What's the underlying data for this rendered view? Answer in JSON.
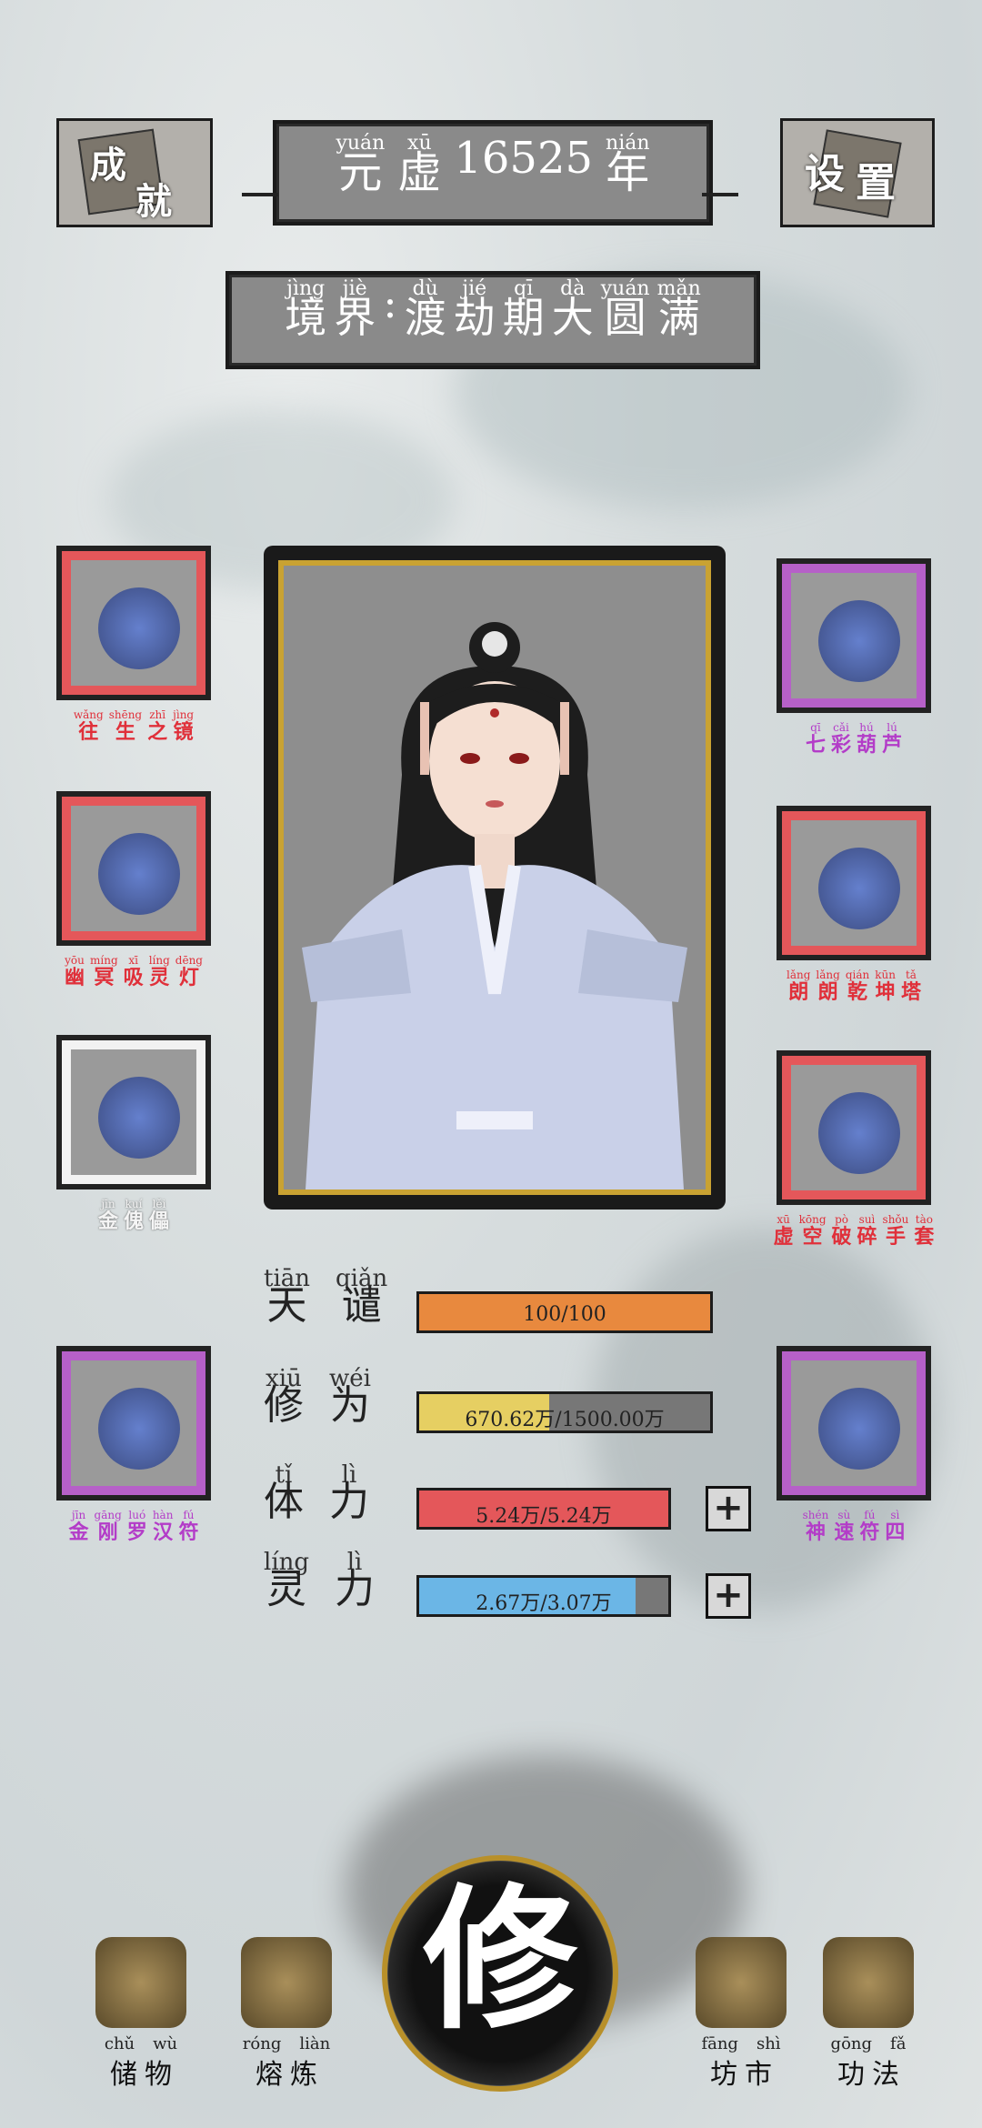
{
  "header": {
    "achievements": [
      "成",
      "就"
    ],
    "settings": [
      "设",
      "置"
    ],
    "era": [
      {
        "py": "yuán",
        "hz": "元"
      },
      {
        "py": "xū",
        "hz": "虚"
      },
      {
        "py": "",
        "hz": "16525"
      },
      {
        "py": "nián",
        "hz": "年"
      }
    ],
    "realm": [
      {
        "py": "jìng",
        "hz": "境"
      },
      {
        "py": "jiè",
        "hz": "界"
      },
      {
        "py": "",
        "hz": ":"
      },
      {
        "py": "dù",
        "hz": "渡"
      },
      {
        "py": "jié",
        "hz": "劫"
      },
      {
        "py": "qī",
        "hz": "期"
      },
      {
        "py": "dà",
        "hz": "大"
      },
      {
        "py": "yuán",
        "hz": "圆"
      },
      {
        "py": "mǎn",
        "hz": "满"
      }
    ]
  },
  "left_items": [
    {
      "py": [
        "wǎng",
        "shēng",
        "zhī",
        "jìng"
      ],
      "hz": [
        "往",
        "生",
        "之",
        "镜"
      ],
      "rarity": "red",
      "icon": "mirror-icon"
    },
    {
      "py": [
        "yōu",
        "míng",
        "xī",
        "líng",
        "dēng"
      ],
      "hz": [
        "幽",
        "冥",
        "吸",
        "灵",
        "灯"
      ],
      "rarity": "red",
      "icon": "lamp-icon"
    },
    {
      "py": [
        "jīn",
        "kuí",
        "lěi"
      ],
      "hz": [
        "金",
        "傀",
        "儡"
      ],
      "rarity": "white",
      "icon": "puppet-icon"
    },
    {
      "py": [
        "jīn",
        "gāng",
        "luó",
        "hàn",
        "fú"
      ],
      "hz": [
        "金",
        "刚",
        "罗",
        "汉",
        "符"
      ],
      "rarity": "purple",
      "icon": "talisman-icon"
    }
  ],
  "right_items": [
    {
      "py": [
        "qī",
        "cǎi",
        "hú",
        "lú"
      ],
      "hz": [
        "七",
        "彩",
        "葫",
        "芦"
      ],
      "rarity": "purple",
      "icon": "gourd-icon"
    },
    {
      "py": [
        "lǎng",
        "lǎng",
        "qián",
        "kūn",
        "tǎ"
      ],
      "hz": [
        "朗",
        "朗",
        "乾",
        "坤",
        "塔"
      ],
      "rarity": "red",
      "icon": "pagoda-icon"
    },
    {
      "py": [
        "xū",
        "kōng",
        "pò",
        "suì",
        "shǒu",
        "tào"
      ],
      "hz": [
        "虚",
        "空",
        "破",
        "碎",
        "手",
        "套"
      ],
      "rarity": "red",
      "icon": "gauntlet-icon"
    },
    {
      "py": [
        "shén",
        "sù",
        "fú",
        "sì"
      ],
      "hz": [
        "神",
        "速",
        "符",
        "四"
      ],
      "rarity": "purple",
      "icon": "talisman-icon"
    }
  ],
  "stats": [
    {
      "py": [
        "tiān",
        "qiǎn"
      ],
      "hz": [
        "天",
        "谴"
      ],
      "text": "100/100",
      "fraction": 1.0,
      "color": "#e8893e",
      "plus": false
    },
    {
      "py": [
        "xiū",
        "wéi"
      ],
      "hz": [
        "修",
        "为"
      ],
      "text": "670.62万/1500.00万",
      "fraction": 0.447,
      "color": "#e6cf62",
      "plus": false
    },
    {
      "py": [
        "tǐ",
        "lì"
      ],
      "hz": [
        "体",
        "力"
      ],
      "text": "5.24万/5.24万",
      "fraction": 1.0,
      "color": "#e4575a",
      "plus": true
    },
    {
      "py": [
        "líng",
        "lì"
      ],
      "hz": [
        "灵",
        "力"
      ],
      "text": "2.67万/3.07万",
      "fraction": 0.87,
      "color": "#6bb6e6",
      "plus": true
    }
  ],
  "plus_label": "+",
  "nav": [
    {
      "py": [
        "chǔ",
        "wù"
      ],
      "hz": [
        "储",
        "物"
      ],
      "icon": "pouch-icon"
    },
    {
      "py": [
        "róng",
        "liàn"
      ],
      "hz": [
        "熔",
        "炼"
      ],
      "icon": "cauldron-icon"
    },
    {
      "center": "修"
    },
    {
      "py": [
        "fāng",
        "shì"
      ],
      "hz": [
        "坊",
        "市"
      ],
      "icon": "coins-icon"
    },
    {
      "py": [
        "gōng",
        "fǎ"
      ],
      "hz": [
        "功",
        "法"
      ],
      "icon": "book-icon"
    }
  ]
}
